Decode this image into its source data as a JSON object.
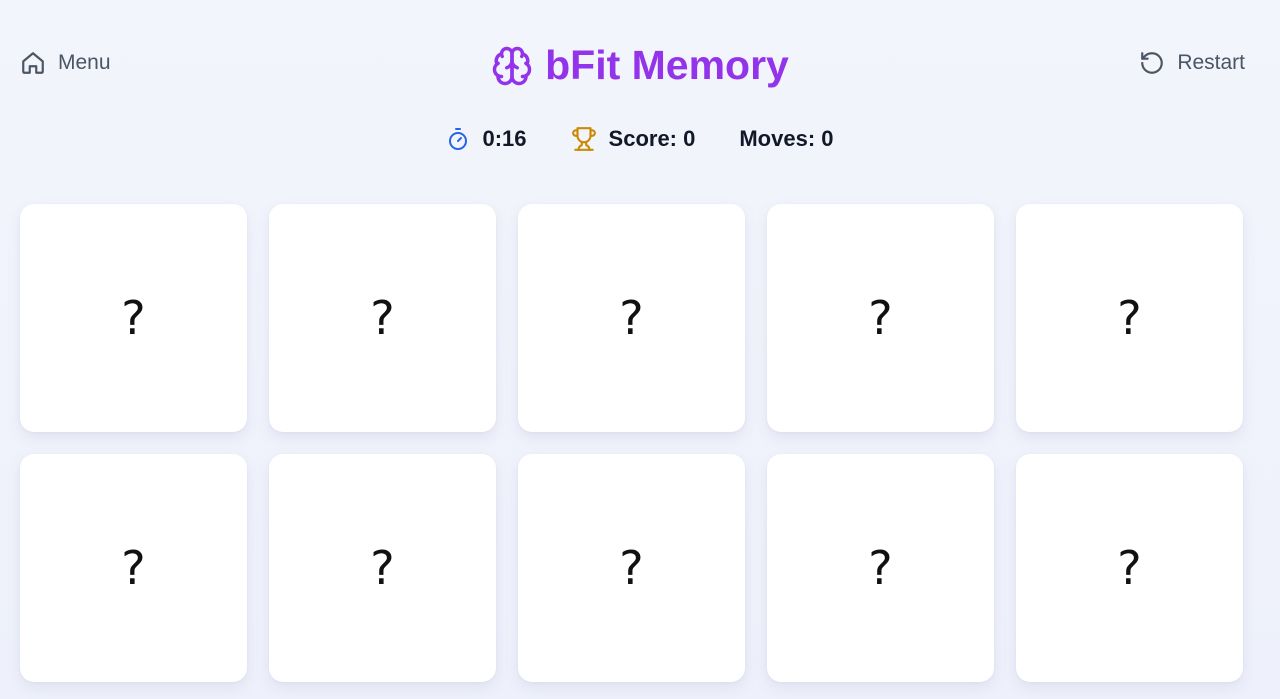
{
  "header": {
    "menu_label": "Menu",
    "menu_icon": "home-icon",
    "title": "bFit Memory",
    "title_icon": "brain-icon",
    "restart_label": "Restart",
    "restart_icon": "rotate-ccw-icon"
  },
  "stats": {
    "timer": "0:16",
    "timer_icon": "timer-icon",
    "score": "Score: 0",
    "score_icon": "trophy-icon",
    "moves": "Moves: 0"
  },
  "colors": {
    "accent": "#9333ea",
    "timer_icon": "#2563eb",
    "trophy_icon": "#ca8a04",
    "background": "#f3f5fc"
  },
  "cards": [
    {
      "face": "?"
    },
    {
      "face": "?"
    },
    {
      "face": "?"
    },
    {
      "face": "?"
    },
    {
      "face": "?"
    },
    {
      "face": "?"
    },
    {
      "face": "?"
    },
    {
      "face": "?"
    },
    {
      "face": "?"
    },
    {
      "face": "?"
    }
  ]
}
